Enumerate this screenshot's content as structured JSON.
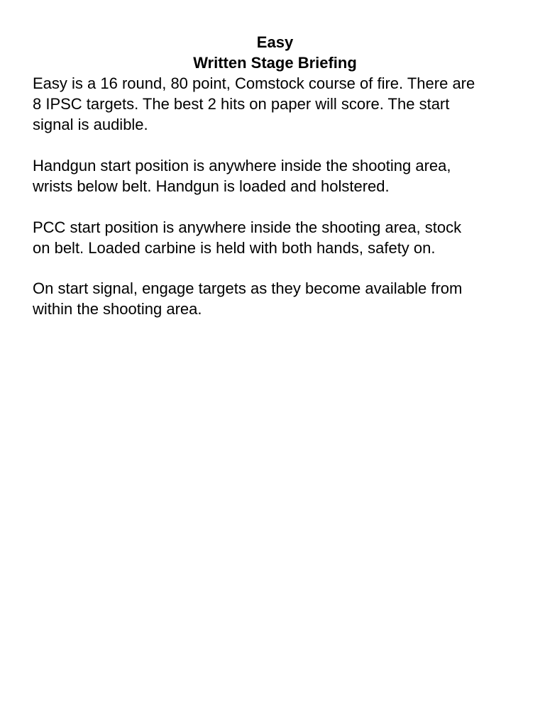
{
  "document": {
    "title": "Easy",
    "subtitle": "Written Stage Briefing",
    "paragraphs": [
      {
        "lines": [
          "Easy is a 16 round, 80 point, Comstock course of fire. There are",
          "8 IPSC targets. The best 2 hits on paper will score. The start",
          "signal is audible."
        ]
      },
      {
        "lines": [
          "Handgun start position is anywhere inside the shooting area,",
          "wrists below belt. Handgun is loaded and holstered."
        ]
      },
      {
        "lines": [
          "PCC start position is anywhere inside the shooting area, stock",
          "on belt. Loaded carbine is held with both hands, safety on."
        ]
      },
      {
        "lines": [
          "On start signal, engage targets as they become available from",
          "within the shooting area."
        ]
      }
    ]
  }
}
